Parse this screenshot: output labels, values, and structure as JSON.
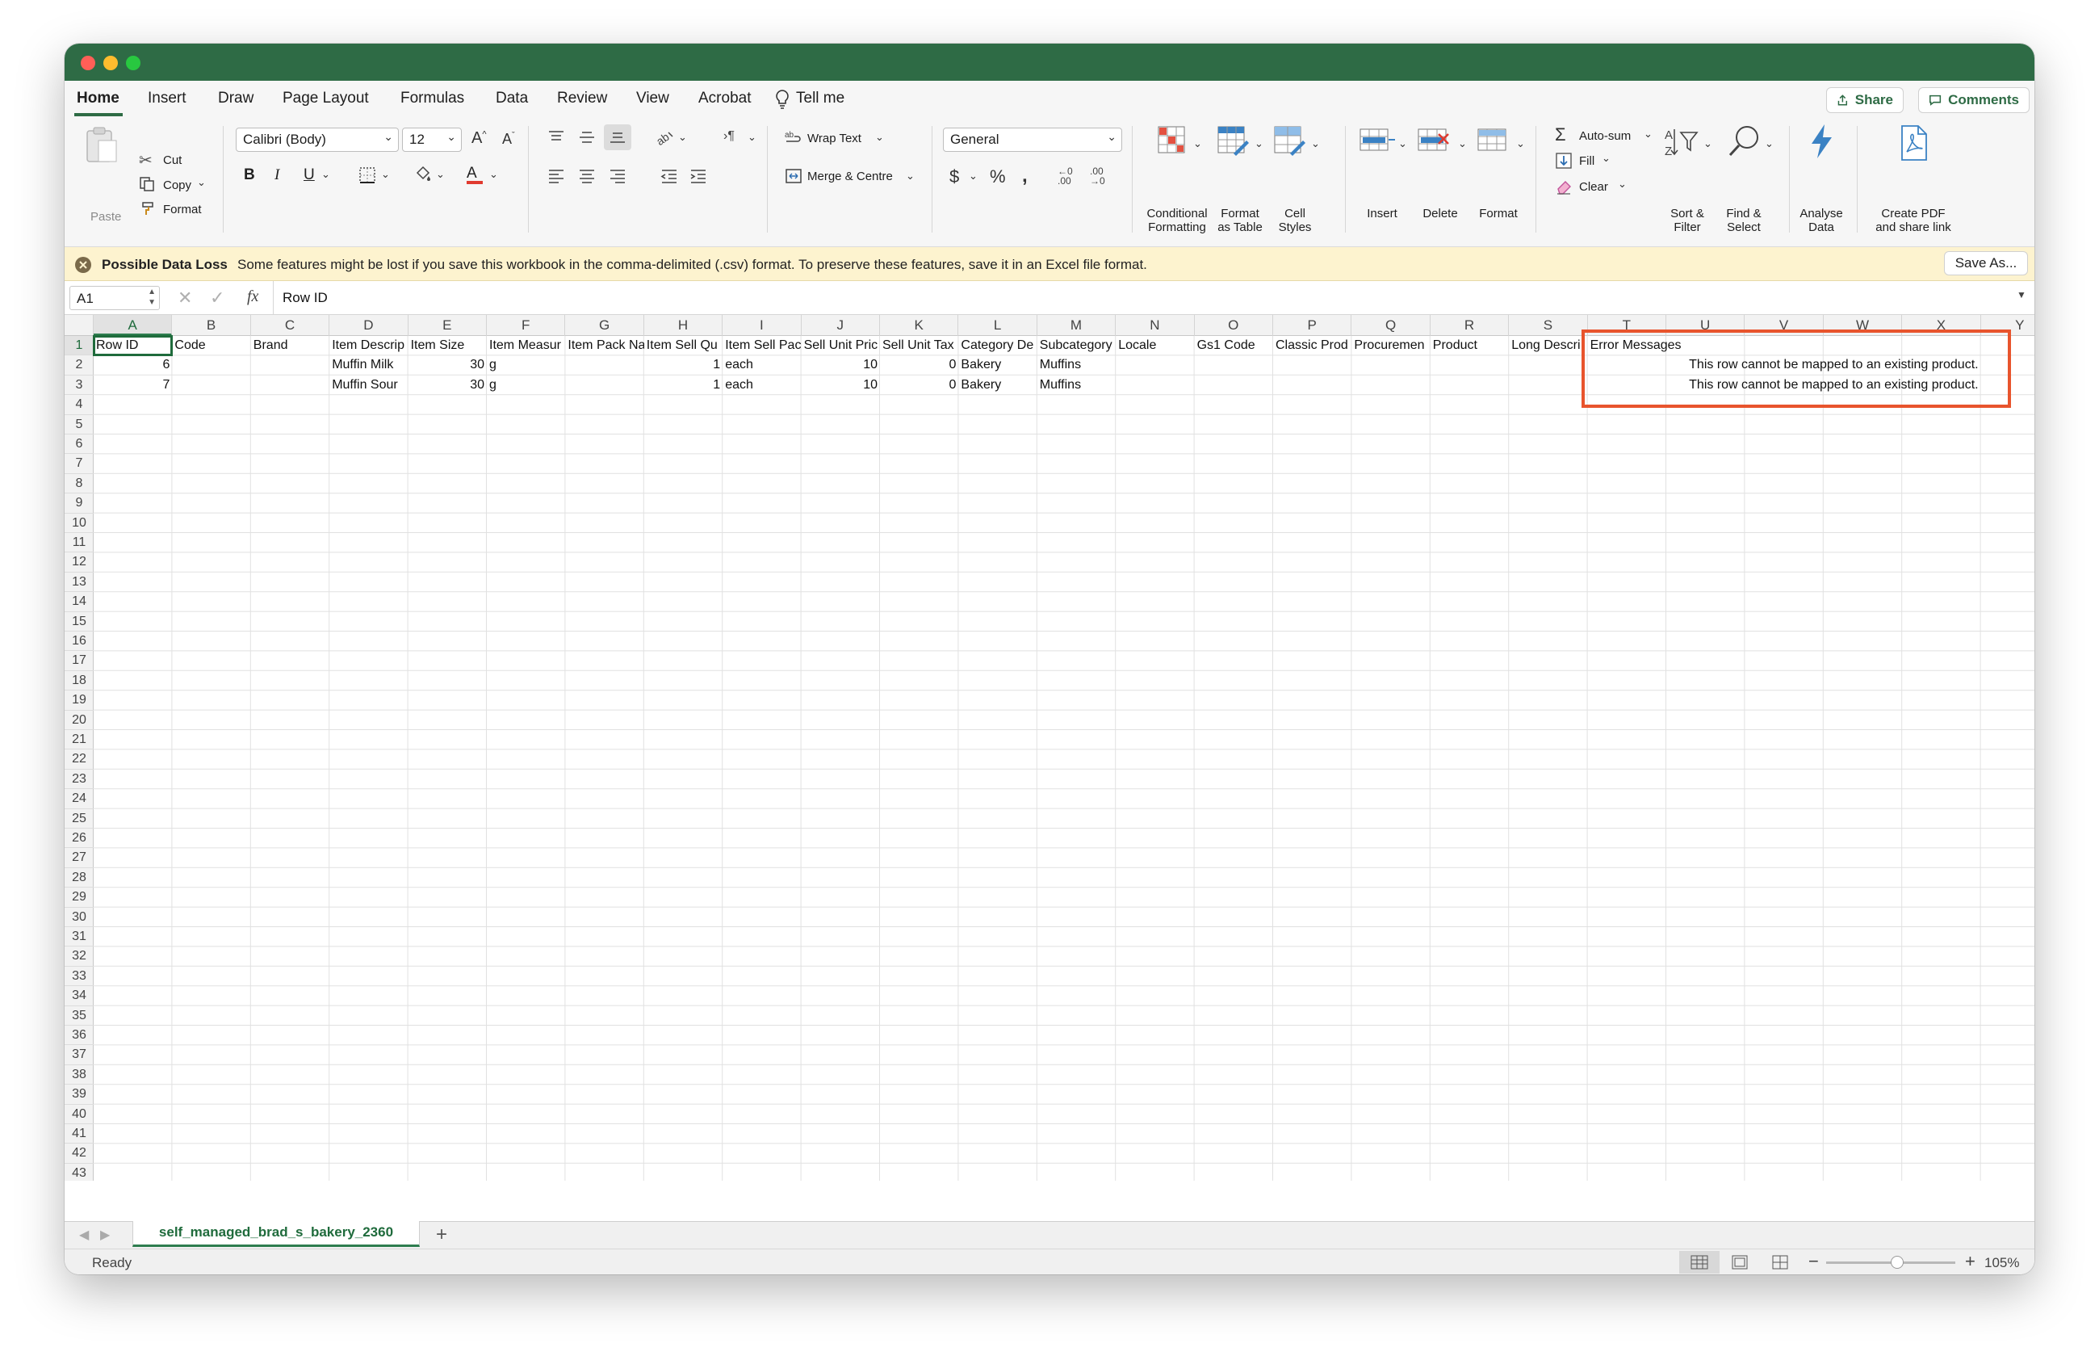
{
  "menubar": {
    "tabs": [
      "Home",
      "Insert",
      "Draw",
      "Page Layout",
      "Formulas",
      "Data",
      "Review",
      "View",
      "Acrobat"
    ],
    "tell_me": "Tell me",
    "share_label": "Share",
    "comments_label": "Comments"
  },
  "ribbon": {
    "paste_label": "Paste",
    "cut_label": "Cut",
    "copy_label": "Copy",
    "format_painter_label": "Format",
    "font_name": "Calibri (Body)",
    "font_size": "12",
    "bold": "B",
    "italic": "I",
    "underline": "U",
    "wrap_text_label": "Wrap Text",
    "merge_label": "Merge & Centre",
    "number_format": "General",
    "conditional_formatting_label": [
      "Conditional",
      "Formatting"
    ],
    "format_as_table_label": [
      "Format",
      "as Table"
    ],
    "cell_styles_label": [
      "Cell",
      "Styles"
    ],
    "insert_label": "Insert",
    "delete_label": "Delete",
    "format_label": "Format",
    "autosum_label": "Auto-sum",
    "fill_label": "Fill",
    "clear_label": "Clear",
    "sort_filter_label": [
      "Sort &",
      "Filter"
    ],
    "find_select_label": [
      "Find &",
      "Select"
    ],
    "analyse_data_label": [
      "Analyse",
      "Data"
    ],
    "create_pdf_label": [
      "Create PDF",
      "and share link"
    ]
  },
  "banner": {
    "title": "Possible Data Loss",
    "message": "Some features might be lost if you save this workbook in the comma-delimited (.csv) format. To preserve these features, save it in an Excel file format.",
    "save_as_label": "Save As..."
  },
  "formula_bar": {
    "name_box": "A1",
    "fx": "fx",
    "content": "Row ID"
  },
  "sheet": {
    "columns": [
      "A",
      "B",
      "C",
      "D",
      "E",
      "F",
      "G",
      "H",
      "I",
      "J",
      "K",
      "L",
      "M",
      "N",
      "O",
      "P",
      "Q",
      "R",
      "S",
      "T",
      "U",
      "V",
      "W",
      "X",
      "Y"
    ],
    "row_count": 47,
    "header_row": [
      "Row ID",
      "Code",
      "Brand",
      "Item Descrip",
      "Item Size",
      "Item Measur",
      "Item Pack Na",
      "Item Sell Qu",
      "Item Sell Pac",
      "Sell Unit Pric",
      "Sell Unit Tax",
      "Category De",
      "Subcategory",
      "Locale",
      "Gs1 Code",
      "Classic Prod",
      "Procuremen",
      "Product",
      "Long Descri",
      "Error Messages"
    ],
    "data_rows": [
      {
        "row_id": "6",
        "item_description": "Muffin Milk",
        "item_size": "30",
        "measure": "g",
        "sell_qty": "1",
        "sell_pack": "each",
        "sell_price": "10",
        "sell_tax": "0",
        "category": "Bakery",
        "subcategory": "Muffins",
        "error": "This row cannot be mapped to an existing product."
      },
      {
        "row_id": "7",
        "item_description": "Muffin Sour",
        "item_size": "30",
        "measure": "g",
        "sell_qty": "1",
        "sell_pack": "each",
        "sell_price": "10",
        "sell_tax": "0",
        "category": "Bakery",
        "subcategory": "Muffins",
        "error": "This row cannot be mapped to an existing product."
      }
    ],
    "selected_cell": "A1",
    "highlight_color": "#e8542d"
  },
  "sheet_tabs": {
    "active_tab": "self_managed_brad_s_bakery_2360",
    "add_label": "+"
  },
  "status": {
    "state": "Ready",
    "zoom": "105%",
    "zoom_fraction": 0.55
  },
  "colors": {
    "titlebar": "#2e6b45",
    "accent": "#2e6b45",
    "banner": "#fdf3cf"
  }
}
